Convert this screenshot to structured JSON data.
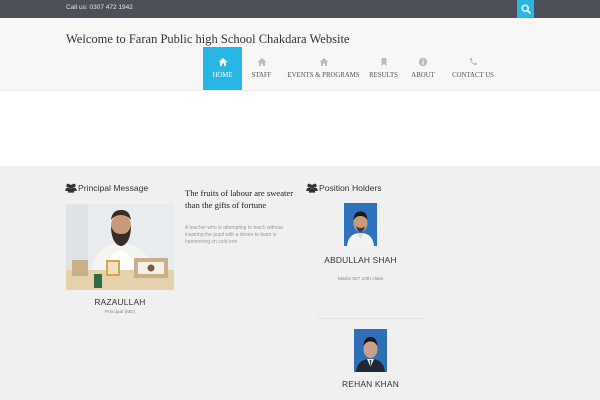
{
  "topbar": {
    "call_text": "Call us: 0307 472 1942",
    "search_icon": "search-icon",
    "accent": "#29b6e5"
  },
  "header": {
    "site_title": "Welcome to Faran Public high School Chakdara Website"
  },
  "nav": {
    "items": [
      {
        "label": "HOME",
        "icon": "home-icon",
        "active": true
      },
      {
        "label": "STAFF",
        "icon": "home-icon",
        "active": false
      },
      {
        "label": "EVENTS & PROGRAMS",
        "icon": "home-icon",
        "active": false
      },
      {
        "label": "RESULTS",
        "icon": "bookmark-icon",
        "active": false
      },
      {
        "label": "ABOUT",
        "icon": "info-icon",
        "active": false
      },
      {
        "label": "CONTACT US",
        "icon": "phone-icon",
        "active": false
      }
    ]
  },
  "principal": {
    "section_title": "Principal Message",
    "section_icon": "users-icon",
    "name": "RAZAULLAH",
    "role": "Principal (MD)"
  },
  "quote": {
    "title": "The fruits of labour are sweater than the gifts of fortune",
    "text": "A teacher who is attempting to teach without inspiring the pupil with a desire to learn is hammering on cold iron"
  },
  "positions": {
    "section_title": "Position Holders",
    "section_icon": "users-icon",
    "holders": [
      {
        "name": "ABDULLAH SHAH",
        "detail": "Marks 927 10th class"
      },
      {
        "name": "REHAN KHAN",
        "detail": ""
      }
    ]
  }
}
